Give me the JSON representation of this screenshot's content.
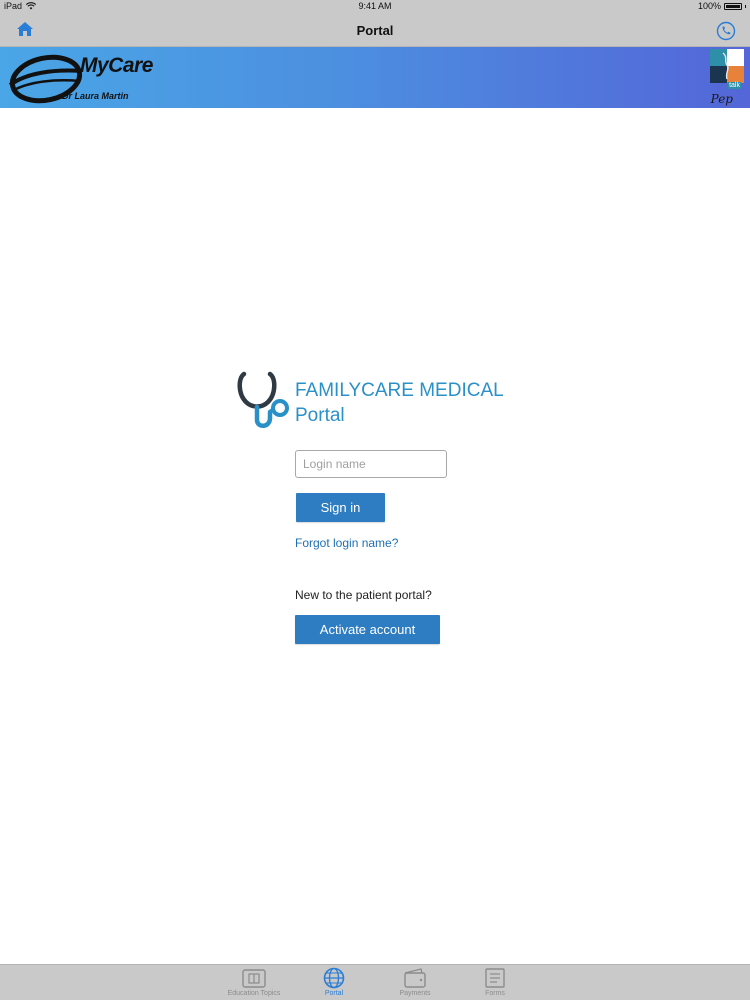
{
  "status_bar": {
    "device": "iPad",
    "time": "9:41 AM",
    "battery": "100%"
  },
  "nav": {
    "title": "Portal",
    "left_icon": "home-icon",
    "right_icon": "phone-icon"
  },
  "banner": {
    "brand_name": "MyCare",
    "brand_sub": "Dr Laura Martin",
    "partner_logo_text": "Pep",
    "partner_logo_badge": "talk"
  },
  "portal": {
    "clinic_name": "FAMILYCARE MEDICAL",
    "subtitle": "Portal",
    "login_placeholder": "Login name",
    "sign_in_label": "Sign in",
    "forgot_label": "Forgot login name?",
    "new_prompt": "New to the patient portal?",
    "activate_label": "Activate account"
  },
  "tabs": [
    {
      "label": "Education Topics",
      "icon": "book-icon",
      "active": false
    },
    {
      "label": "Portal",
      "icon": "globe-icon",
      "active": true
    },
    {
      "label": "Payments",
      "icon": "wallet-icon",
      "active": false
    },
    {
      "label": "Forms",
      "icon": "document-icon",
      "active": false
    }
  ],
  "colors": {
    "accent": "#2e7cc2",
    "brand_text": "#2a90c8",
    "tab_active": "#2a7dd6",
    "bar_gray": "#c9c9c9"
  }
}
